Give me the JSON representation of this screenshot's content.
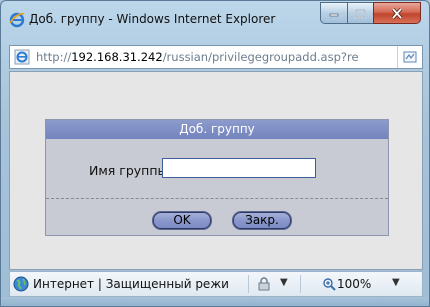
{
  "window": {
    "title": "Доб. группу - Windows Internet Explorer",
    "controls": {
      "minimize": "minimize",
      "maximize": "maximize",
      "close": "close"
    }
  },
  "address": {
    "url_prefix": "http://",
    "url_host": "192.168.31.242",
    "url_path": "/russian/privilegegroupadd.asp?re",
    "icon": "ie-page-icon"
  },
  "dialog": {
    "header": "Доб. группу",
    "name_label": "Имя группы:",
    "name_value": "",
    "ok_label": "OK",
    "close_label": "Закр."
  },
  "status": {
    "text": "Интернет | Защищенный режи",
    "zoom": "100%"
  },
  "colors": {
    "dialog_header": "#7d8dc3",
    "dialog_bg": "#c9cbd4",
    "button": "#8997cb",
    "close_button": "#c94a33"
  }
}
